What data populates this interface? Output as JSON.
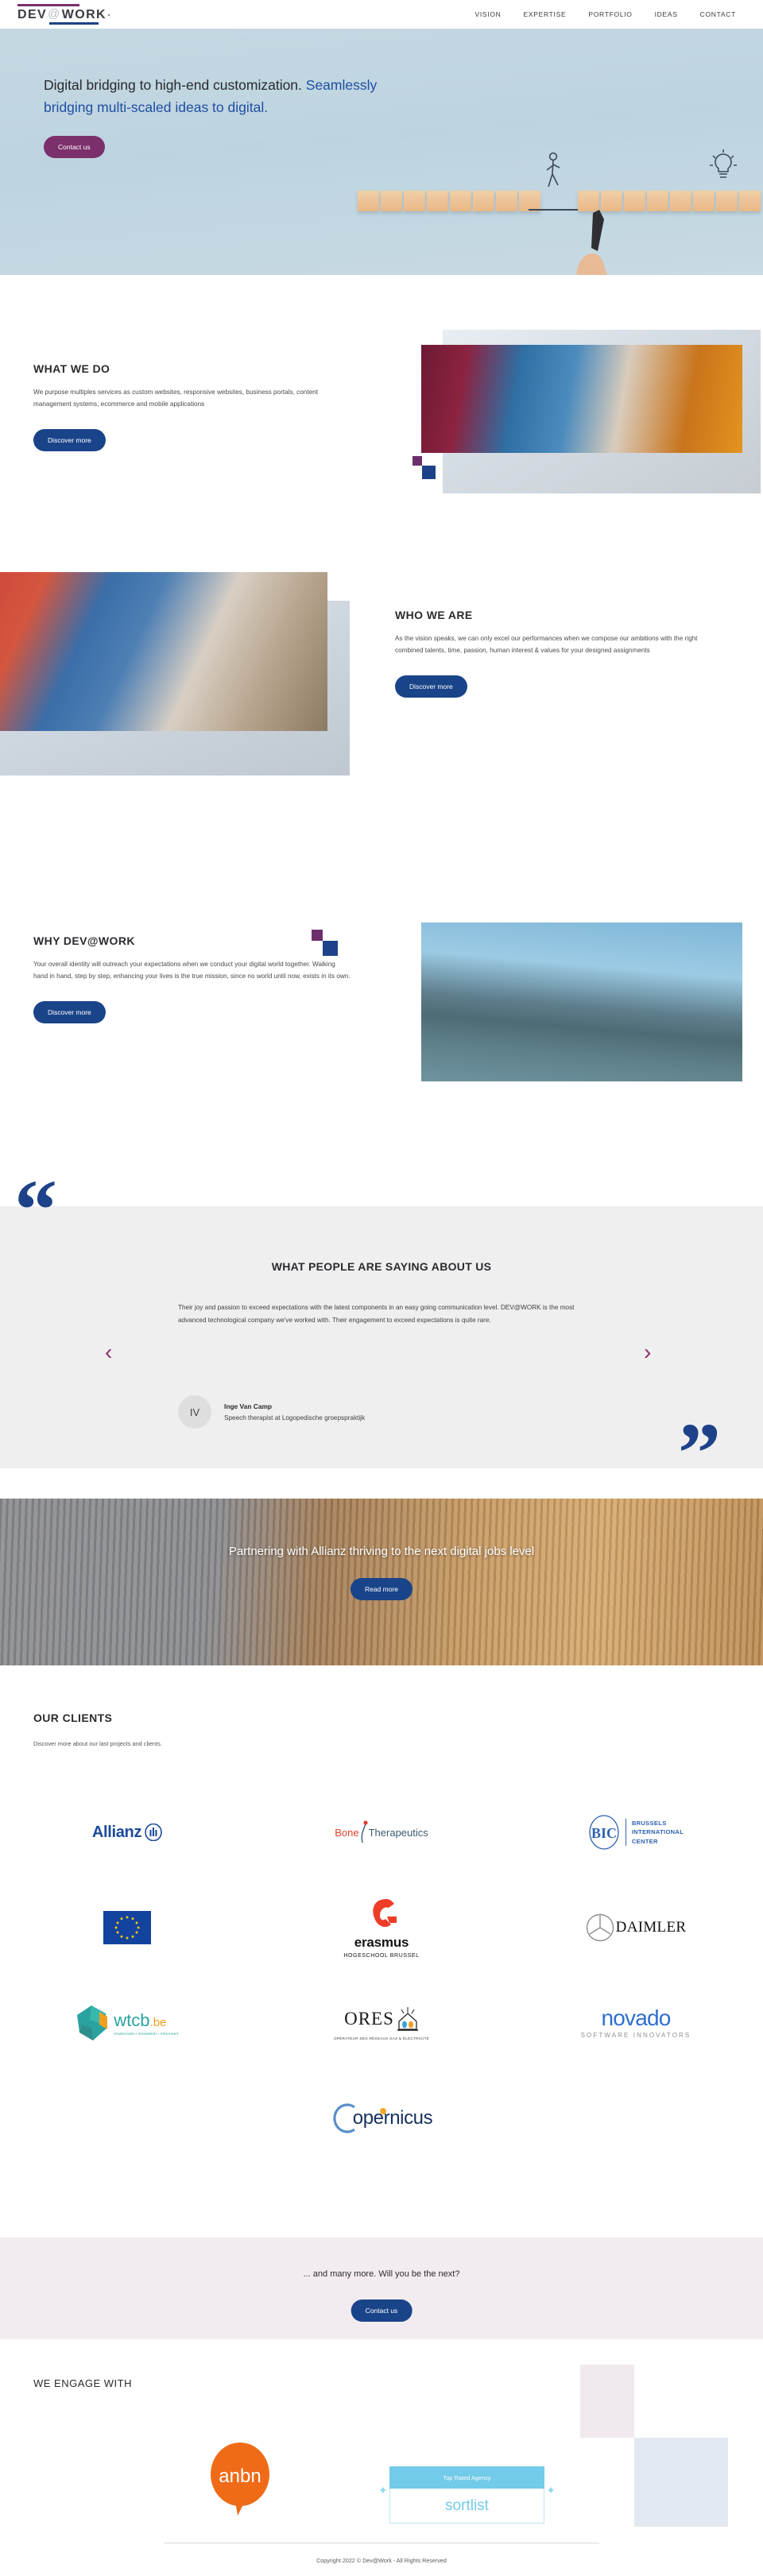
{
  "header": {
    "logo": {
      "dev": "DEV",
      "at": "@",
      "work": "WORK"
    },
    "nav": [
      {
        "label": "VISION"
      },
      {
        "label": "EXPERTISE"
      },
      {
        "label": "PORTFOLIO"
      },
      {
        "label": "IDEAS"
      },
      {
        "label": "CONTACT"
      }
    ]
  },
  "hero": {
    "title_dark": "Digital bridging to high-end customization. ",
    "title_accent": "Seamlessly bridging multi-scaled ideas to digital.",
    "cta": "Contact us"
  },
  "what_we_do": {
    "title": "WHAT WE DO",
    "body": "We purpose multiples services as custom websites, responsive websites, business portals, content management systems, ecommerce and mobile applications",
    "cta": "Discover more"
  },
  "who_we_are": {
    "title": "WHO WE ARE",
    "body": "As the vision speaks, we can only excel our performances when we compose our ambitions with the right combined talents, time, passion, human interest & values for your designed assignments",
    "cta": "Discover more"
  },
  "why_devatwork": {
    "title": "WHY DEV@WORK",
    "body": "Your overall identity will outreach your expectations when we conduct your digital world together. Walking hand in hand, step by step, enhancing your lives is the true mission, since no world until now, exists in its own.",
    "cta": "Discover more"
  },
  "testimonial": {
    "title": "WHAT PEOPLE ARE SAYING ABOUT US",
    "quote": "Their joy and passion to exceed expectations with the latest components in an easy going communication level. DEV@WORK is the most advanced technological company we've worked with. Their engagement to exceed expectations is quite rare.",
    "author_initials": "IV",
    "author_name": "Inge Van Camp",
    "author_role": "Speech therapist at Logopedische groepspraktijk",
    "prev": "‹",
    "next": "›",
    "quote_open": "“",
    "quote_close": "”"
  },
  "banner": {
    "title": "Partnering with Allianz thriving to the next digital jobs level",
    "cta": "Read more"
  },
  "clients": {
    "title": "OUR CLIENTS",
    "subtitle": "Discover more about our last projects and clients.",
    "logos": [
      {
        "name": "Allianz",
        "id": "allianz"
      },
      {
        "name": "Bone Therapeutics",
        "id": "bone-therapeutics"
      },
      {
        "name": "Brussels International Center",
        "id": "bic"
      },
      {
        "name": "European Union",
        "id": "european-union"
      },
      {
        "name": "Erasmus Hogeschool Brussel",
        "id": "erasmus"
      },
      {
        "name": "Daimler",
        "id": "daimler"
      },
      {
        "name": "wtcb.be",
        "id": "wtcb"
      },
      {
        "name": "ORES",
        "id": "ores"
      },
      {
        "name": "Novado Software Innovators",
        "id": "novado"
      },
      {
        "name": "Copernicus",
        "id": "copernicus"
      }
    ],
    "logo_text": {
      "allianz": "Allianz",
      "bone_1": "Bone",
      "bone_2": "Therapeutics",
      "bic_mark": "BIC",
      "bic_l1": "BRUSSELS",
      "bic_l2": "INTERNATIONAL",
      "bic_l3": "CENTER",
      "erasmus_1": "erasmus",
      "erasmus_2": "HOGESCHOOL  BRUSSEL",
      "daimler": "DAIMLER",
      "wtcb_1": "wtcb",
      "wtcb_2": ".be",
      "wtcb_3": "Onderzoekt • Ontwikkelt • Informeert",
      "ores_1": "ORES",
      "ores_2": "OPÉRATEUR DES RÉSEAUX GAZ & ÉLECTRICITÉ",
      "novado_1": "novado",
      "novado_2": "SOFTWARE INNOVATORS",
      "copernicus": "opernicus"
    }
  },
  "more": {
    "text": "... and many more. Will you be the next?",
    "cta": "Contact us"
  },
  "engage": {
    "title": "WE ENGAGE WITH",
    "anbn": "anbn",
    "sortlist_badge": "Top Rated Agency",
    "sortlist_name": "sortlist"
  },
  "footer": {
    "copyright": "Copyright 2022 © Dev@Work - All Rights Reserved"
  },
  "colors": {
    "purple": "#7b2f6b",
    "blue": "#1a4489",
    "accent_blue": "#1f4fa3",
    "hero_bg": "#c5d8e2",
    "testimonial_bg": "#efefef",
    "more_bg": "#f2ecf0"
  }
}
